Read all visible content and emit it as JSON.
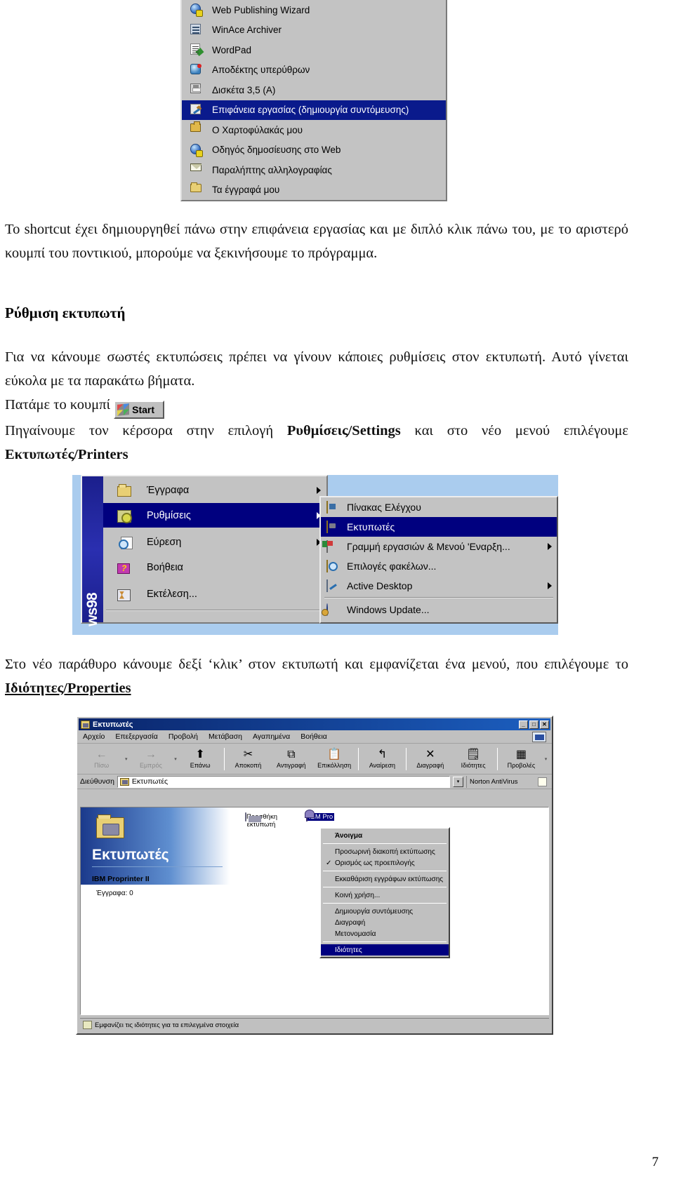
{
  "document": {
    "page_number": "7",
    "paragraphs": {
      "p1": "Το shortcut έχει δημιουργηθεί πάνω στην επιφάνεια εργασίας και με διπλό κλικ πάνω του, με το αριστερό κουμπί του ποντικιού, μπορούμε να ξεκινήσουμε το πρόγραμμα.",
      "heading1": "Ρύθμιση εκτυπωτή",
      "p2": "Για να κάνουμε σωστές εκτυπώσεις πρέπει να γίνουν κάποιες ρυθμίσεις στον εκτυπωτή. Αυτό γίνεται εύκολα με τα παρακάτω βήματα.",
      "p3_prefix": "Πατάμε το  κουμπί",
      "p4_a": "Πηγαίνουμε τον κέρσορα στην επιλογή ",
      "p4_b_bold": "Ρυθμίσεις/Settings",
      "p4_c": " και στο νέο μενού επιλέγουμε ",
      "p4_d_bold": "Εκτυπωτές/Printers",
      "p5_a": "Στο νέο παράθυρο κάνουμε δεξί ‘κλικ’ στον εκτυπωτή και εμφανίζεται ένα μενού, που επιλέγουμε το ",
      "p5_b_bold": "Ιδιότητες/Properties"
    }
  },
  "start_button": {
    "label": "Start",
    "icon": "windows-flag-icon"
  },
  "program_menu": {
    "items": [
      {
        "label": "Web Publishing Wizard",
        "icon": "web-globe-icon",
        "selected": false
      },
      {
        "label": "WinAce Archiver",
        "icon": "winace-icon",
        "selected": false
      },
      {
        "label": "WordPad",
        "icon": "wordpad-icon",
        "selected": false
      },
      {
        "label": "Αποδέκτης υπερύθρων",
        "icon": "infrared-icon",
        "selected": false
      },
      {
        "label": "Δισκέτα 3,5 (A)",
        "icon": "floppy-icon",
        "selected": false
      },
      {
        "label": "Επιφάνεια εργασίας (δημιουργία συντόμευσης)",
        "icon": "desktop-shortcut-icon",
        "selected": true
      },
      {
        "label": "Ο Χαρτοφύλακάς μου",
        "icon": "briefcase-icon",
        "selected": false
      },
      {
        "label": "Οδηγός δημοσίευσης στο Web",
        "icon": "web-publish-icon",
        "selected": false
      },
      {
        "label": "Παραλήπτης αλληλογραφίας",
        "icon": "mail-icon",
        "selected": false
      },
      {
        "label": "Τα έγγραφά μου",
        "icon": "my-documents-icon",
        "selected": false
      }
    ]
  },
  "start_menu": {
    "banner_text": "ws98",
    "items": [
      {
        "label": "Έγγραφα",
        "icon": "documents-icon",
        "selected": false,
        "has_submenu": true
      },
      {
        "label": "Ρυθμίσεις",
        "icon": "settings-gear-icon",
        "selected": true,
        "has_submenu": true
      },
      {
        "label": "Εύρεση",
        "icon": "find-icon",
        "selected": false,
        "has_submenu": true
      },
      {
        "label": "Βοήθεια",
        "icon": "help-book-icon",
        "selected": false,
        "has_submenu": false
      },
      {
        "label": "Εκτέλεση...",
        "icon": "run-icon",
        "selected": false,
        "has_submenu": false
      }
    ],
    "submenu": [
      {
        "label": "Πίνακας Ελέγχου",
        "icon": "control-panel-icon",
        "selected": false,
        "has_submenu": false
      },
      {
        "label": "Εκτυπωτές",
        "icon": "printers-folder-icon",
        "selected": true,
        "has_submenu": false
      },
      {
        "label": "Γραμμή εργασιών & Μενού 'Εναρξη...",
        "icon": "taskbar-icon",
        "selected": false,
        "has_submenu": true
      },
      {
        "label": "Επιλογές φακέλων...",
        "icon": "folder-options-icon",
        "selected": false,
        "has_submenu": false
      },
      {
        "label": "Active Desktop",
        "icon": "active-desktop-icon",
        "selected": false,
        "has_submenu": true
      },
      {
        "label": "Windows Update...",
        "icon": "windows-update-icon",
        "selected": false,
        "has_submenu": false
      }
    ]
  },
  "printers_window": {
    "title": "Εκτυπωτές",
    "window_buttons": {
      "minimize": "_",
      "maximize": "□",
      "close": "✕"
    },
    "menus": [
      "Αρχείο",
      "Επεξεργασία",
      "Προβολή",
      "Μετάβαση",
      "Αγαπημένα",
      "Βοήθεια"
    ],
    "toolbar": [
      {
        "label": "Πίσω",
        "icon": "back-arrow-icon",
        "disabled": true
      },
      {
        "label": "Εμπρός",
        "icon": "forward-arrow-icon",
        "disabled": true
      },
      {
        "label": "Επάνω",
        "icon": "up-folder-icon",
        "disabled": false
      },
      {
        "label": "Αποκοπή",
        "icon": "scissors-icon",
        "disabled": false
      },
      {
        "label": "Αντιγραφή",
        "icon": "copy-icon",
        "disabled": false
      },
      {
        "label": "Επικόλληση",
        "icon": "paste-icon",
        "disabled": false
      },
      {
        "label": "Αναίρεση",
        "icon": "undo-icon",
        "disabled": false
      },
      {
        "label": "Διαγραφή",
        "icon": "delete-x-icon",
        "disabled": false
      },
      {
        "label": "Ιδιότητες",
        "icon": "properties-icon",
        "disabled": false
      },
      {
        "label": "Προβολές",
        "icon": "views-icon",
        "disabled": false
      }
    ],
    "address_label": "Διεύθυνση",
    "address_value": "Εκτυπωτές",
    "antivirus_label": "Norton AntiVirus",
    "heading": "Εκτυπωτές",
    "device_name": "IBM Proprinter II",
    "device_documents": "Έγγραφα: 0",
    "icons": [
      {
        "label": "Προσθήκη εκτυπωτή",
        "icon": "add-printer-icon",
        "selected": false
      },
      {
        "label": "IBM Pro",
        "icon": "printer-icon",
        "selected": true
      }
    ],
    "context_menu": [
      {
        "label": "Άνοιγμα",
        "bold": true,
        "checked": false,
        "selected": false
      },
      {
        "separator": true
      },
      {
        "label": "Προσωρινή διακοπή εκτύπωσης",
        "bold": false,
        "checked": false,
        "selected": false
      },
      {
        "label": "Ορισμός ως προεπιλογής",
        "bold": false,
        "checked": true,
        "selected": false
      },
      {
        "separator": true
      },
      {
        "label": "Εκκαθάριση εγγράφων εκτύπωσης",
        "bold": false,
        "checked": false,
        "selected": false
      },
      {
        "separator": true
      },
      {
        "label": "Κοινή χρήση...",
        "bold": false,
        "checked": false,
        "selected": false
      },
      {
        "separator": true
      },
      {
        "label": "Δημιουργία συντόμευσης",
        "bold": false,
        "checked": false,
        "selected": false
      },
      {
        "label": "Διαγραφή",
        "bold": false,
        "checked": false,
        "selected": false
      },
      {
        "label": "Μετονομασία",
        "bold": false,
        "checked": false,
        "selected": false
      },
      {
        "separator": true
      },
      {
        "label": "Ιδιότητες",
        "bold": false,
        "checked": false,
        "selected": true
      }
    ],
    "status_text": "Εμφανίζει τις ιδιότητες για τα επιλεγμένα στοιχεία"
  }
}
